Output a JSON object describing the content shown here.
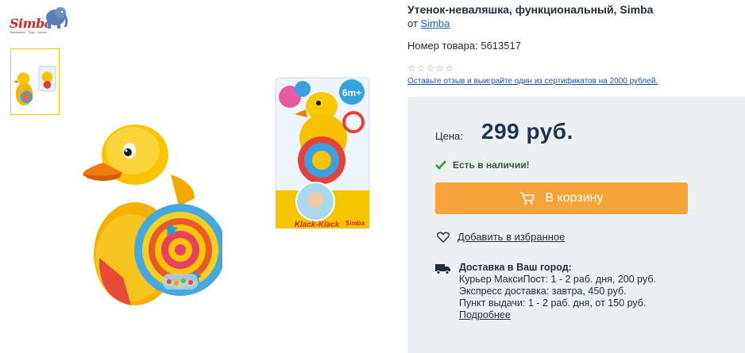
{
  "brand": {
    "logo_text": "Simba",
    "logo_tagline": "Spielwaren · Toys · Jouets"
  },
  "product": {
    "title": "Утенок-неваляшка, функциональный, Simba",
    "by_prefix": "от",
    "by_brand": "Simba",
    "sku_label": "Номер товара: 5613517",
    "rating_stars": 0,
    "rating_max": 5,
    "review_prompt": "Оставьте отзыв и выиграйте один из сертификатов на 2000 рублей."
  },
  "package": {
    "age_badge": "6m+",
    "toy_name": "Klack-Klack",
    "brand_mark": "Simba"
  },
  "buy": {
    "price_label": "Цена:",
    "price_value": "299 руб.",
    "stock_text": "Есть в наличии!",
    "cart_label": "В корзину",
    "favorite_label": "Добавить в избранное"
  },
  "delivery": {
    "heading": "Доставка в Ваш город:",
    "lines": [
      "Курьер МаксиПост: 1 - 2 раб. дня, 200 руб.",
      "Экспресс доставка: завтра, 450 руб.",
      "Пункт выдачи: 1 - 2 раб. дня, от 150 руб."
    ],
    "more_link": "Подробнее"
  },
  "colors": {
    "accent_orange": "#f6a339",
    "link_blue": "#1e63c7",
    "panel_bg": "#edf0f3",
    "stock_green": "#2f9a2f",
    "price_navy": "#1f3556"
  },
  "icons": [
    "cart-icon",
    "heart-icon",
    "truck-icon",
    "check-icon",
    "star-icon"
  ]
}
